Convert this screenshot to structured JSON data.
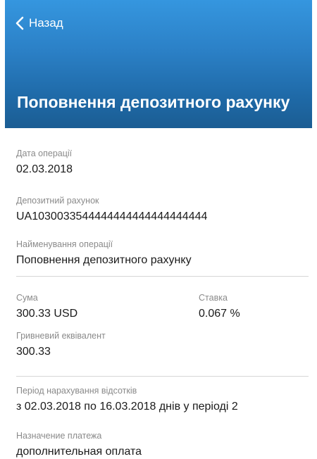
{
  "header": {
    "back_label": "Назад",
    "title": "Поповнення депозитного рахунку",
    "gradient_top": "#3596df",
    "gradient_bottom": "#1b5d93"
  },
  "fields": {
    "operation_date": {
      "label": "Дата операції",
      "value": "02.03.2018"
    },
    "deposit_account": {
      "label": "Депозитний рахунок",
      "value": "UA1030033544444444444444444444"
    },
    "operation_name": {
      "label": "Найменування операції",
      "value": "Поповнення депозитного рахунку"
    },
    "amount": {
      "label": "Сума",
      "value": "300.33 USD"
    },
    "rate": {
      "label": "Ставка",
      "value": "0.067 %"
    },
    "uah_equivalent": {
      "label": "Гривневий еквівалент",
      "value": "300.33"
    },
    "interest_period": {
      "label": "Період нарахування відсотків",
      "value": "з 02.03.2018 по 16.03.2018 днів у періоді 2"
    },
    "payment_purpose": {
      "label": "Назначение платежа",
      "value": "дополнительная оплата"
    }
  }
}
